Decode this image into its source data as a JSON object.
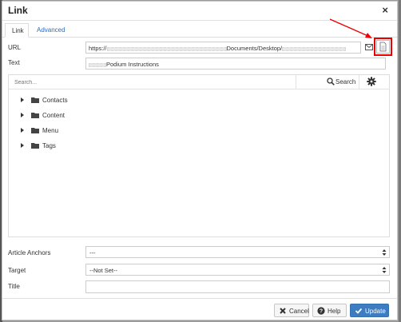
{
  "dialog": {
    "title": "Link",
    "close_symbol": "×"
  },
  "tabs": [
    {
      "label": "Link",
      "active": true
    },
    {
      "label": "Advanced",
      "active": false
    }
  ],
  "fields": {
    "url_label": "URL",
    "url_prefix": "https://",
    "url_middle": "Documents/Desktop/",
    "text_label": "Text",
    "text_value": "Podium Instructions",
    "article_anchors_label": "Article Anchors",
    "article_anchors_value": "---",
    "target_label": "Target",
    "target_value": "--Not Set--",
    "title_label": "Title",
    "title_value": ""
  },
  "browser": {
    "search_placeholder": "Search...",
    "search_button": "Search",
    "tree": [
      {
        "label": "Contacts",
        "icon": "folder-icon"
      },
      {
        "label": "Content",
        "icon": "folder-icon"
      },
      {
        "label": "Menu",
        "icon": "folder-icon"
      },
      {
        "label": "Tags",
        "icon": "folder-icon"
      }
    ]
  },
  "buttons": {
    "cancel": "Cancel",
    "help": "Help",
    "update": "Update"
  },
  "colors": {
    "accent": "#3e7cc1",
    "annotation": "#e00000"
  }
}
